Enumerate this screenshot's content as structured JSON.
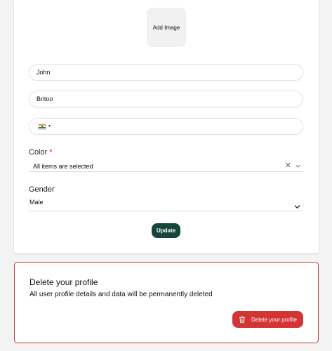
{
  "profile": {
    "add_image_label": "Add Image",
    "first_name": "John",
    "last_name": "Britoo",
    "phone_value": "",
    "phone_country_icon": "india-flag-icon",
    "color": {
      "label": "Color",
      "required_mark": "*",
      "selected_text": "All items are selected"
    },
    "gender": {
      "label": "Gender",
      "selected": "Male"
    },
    "update_label": "Update"
  },
  "delete_section": {
    "title": "Delete your profile",
    "description": "All user profile details and data will be permanently deleted",
    "button_label": "Delete your profile",
    "button_icon": "trash-icon"
  },
  "colors": {
    "update_button": "#16453b",
    "delete_accent": "#d33434",
    "page_bg": "#f3f3f3"
  }
}
